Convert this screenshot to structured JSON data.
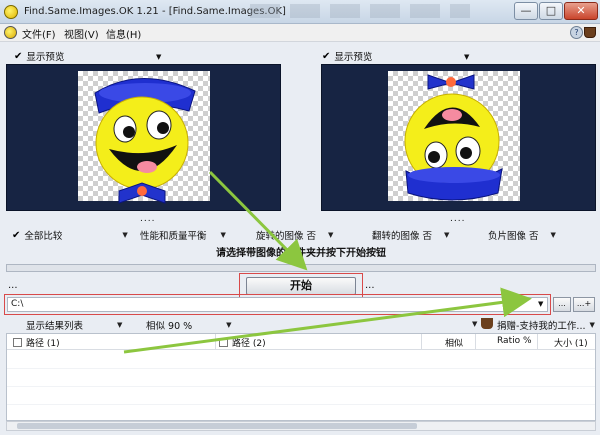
{
  "window": {
    "title": "Find.Same.Images.OK 1.21 - [Find.Same.Images.OK]",
    "controls": {
      "minimize": "—",
      "maximize": "□",
      "close": "✕"
    }
  },
  "menu": {
    "items": [
      "文件(F)",
      "视图(V)",
      "信息(H)"
    ],
    "help_icon": "?"
  },
  "left_panel": {
    "toggle_label": "显示预览",
    "footer": "....",
    "icon": "smiley-with-hat-icon"
  },
  "right_panel": {
    "toggle_label": "显示预览",
    "footer": "....",
    "icon": "smiley-with-hat-rotated-icon"
  },
  "compare_options": [
    {
      "label": "全部比较",
      "checked": true
    },
    {
      "label": "性能和质量平衡",
      "checked": false
    },
    {
      "label": "旋转的图像 否",
      "checked": false
    },
    {
      "label": "翻转的图像 否",
      "checked": false
    },
    {
      "label": "负片图像 否",
      "checked": false
    }
  ],
  "info_text": "请选择带图像的文件夹并按下开始按钮",
  "progress": 0,
  "start_button": "开始",
  "side_dots": "...",
  "path": {
    "value": "C:\\",
    "browse_label": "...",
    "add_label": "...+"
  },
  "results_bar": {
    "view_mode": "显示结果列表",
    "similarity": "相似 90 %",
    "donate": "捐赠-支持我的工作..."
  },
  "table": {
    "headers": [
      "路径 (1)",
      "路径 (2)",
      "相似",
      "Ratio %",
      "大小 (1)"
    ],
    "rows": []
  },
  "colors": {
    "preview_bg": "#172443",
    "highlight_border": "#d84a4a",
    "arrow": "#8cc63f",
    "face_yellow": "#f4ee1a",
    "hat_blue": "#2233cc"
  }
}
